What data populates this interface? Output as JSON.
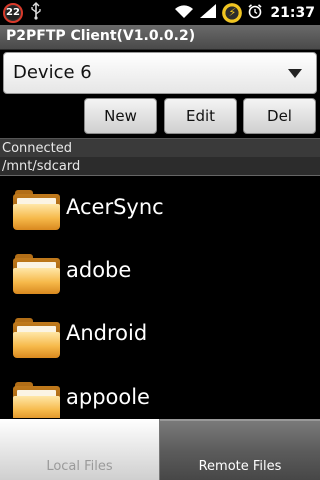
{
  "status_bar": {
    "notification_count": "22",
    "time": "21:37",
    "icons": [
      "notification-count-badge",
      "usb-icon",
      "wifi-icon",
      "signal-icon",
      "battery-icon",
      "alarm-icon"
    ]
  },
  "app": {
    "title": "P2PFTP Client(V1.0.0.2)"
  },
  "device_selector": {
    "selected": "Device 6"
  },
  "buttons": {
    "new": "New",
    "edit": "Edit",
    "del": "Del"
  },
  "status": {
    "connection": "Connected",
    "path": "/mnt/sdcard"
  },
  "files": [
    {
      "name": "AcerSync",
      "icon": "folder-icon"
    },
    {
      "name": "adobe",
      "icon": "folder-icon"
    },
    {
      "name": "Android",
      "icon": "folder-icon"
    },
    {
      "name": "appoole",
      "icon": "folder-icon"
    }
  ],
  "tabs": {
    "local": "Local Files",
    "remote": "Remote Files",
    "active": "remote"
  },
  "colors": {
    "folder": "#f6b94a",
    "title_bar": "#5a5a5a",
    "battery_ring": "#f0c420",
    "badge_ring": "#d83a2b"
  }
}
